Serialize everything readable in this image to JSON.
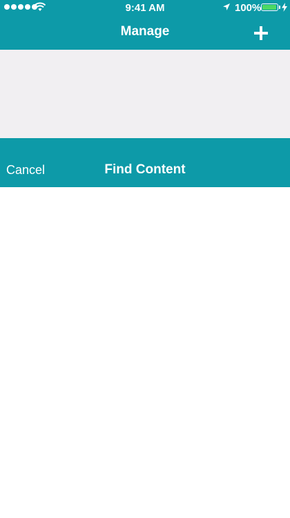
{
  "status_bar": {
    "time": "9:41 AM",
    "battery_percent": "100%",
    "icons": [
      "signal-dots-icon",
      "wifi-icon",
      "location-arrow-icon",
      "battery-icon",
      "charging-bolt-icon"
    ]
  },
  "nav": {
    "title": "Manage",
    "add_icon": "plus-icon"
  },
  "find_bar": {
    "cancel_label": "Cancel",
    "title": "Find Content"
  },
  "colors": {
    "accent": "#0d9aa8",
    "gray_panel": "#f1eff2",
    "battery_green": "#4cd964"
  }
}
